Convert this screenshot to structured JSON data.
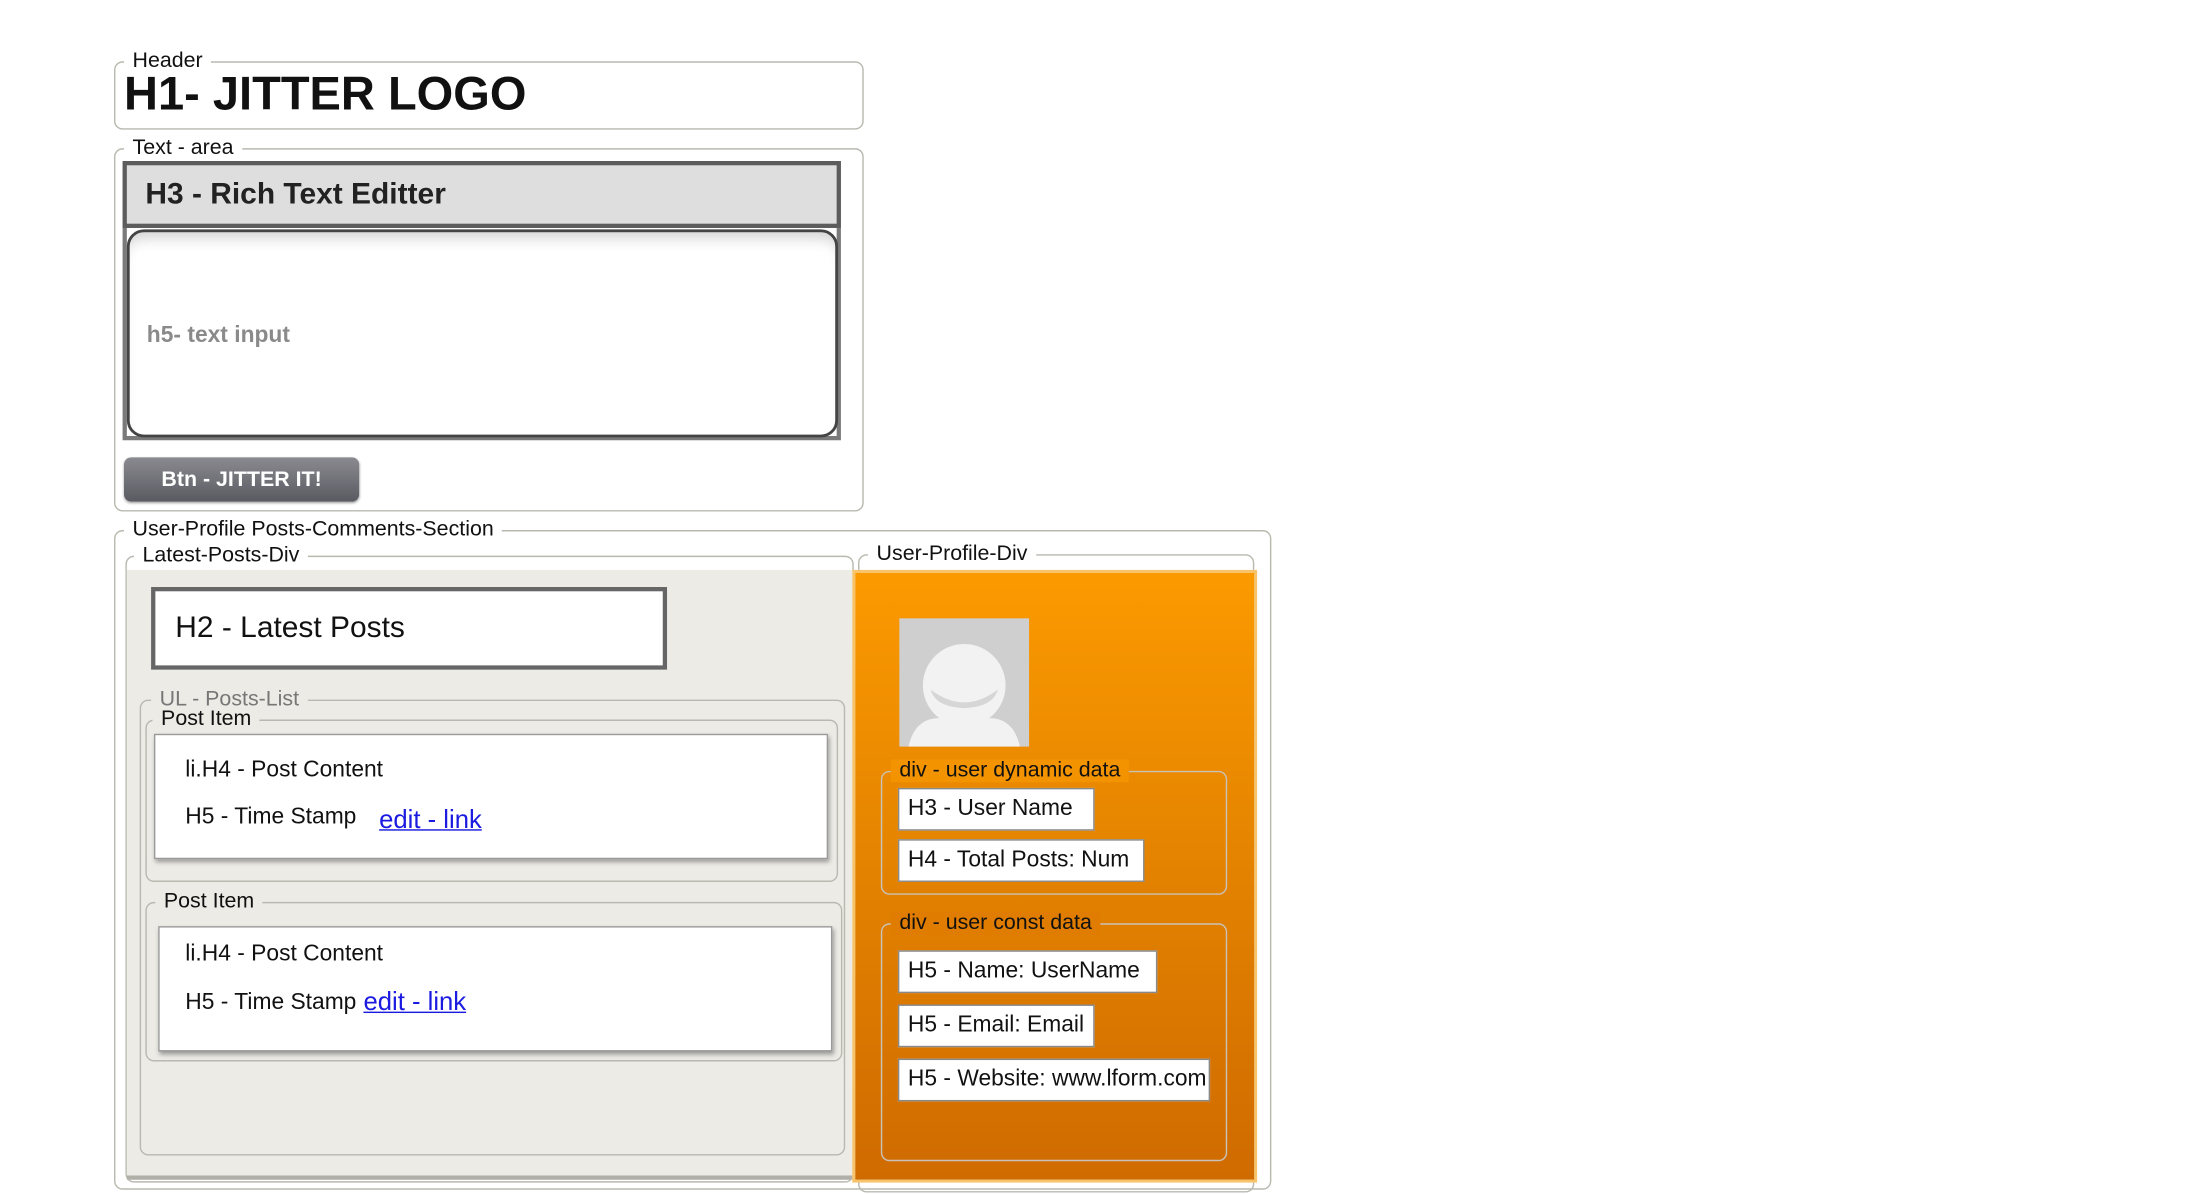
{
  "header": {
    "legend": "Header",
    "logo": "H1- JITTER LOGO"
  },
  "text_area": {
    "legend": "Text - area",
    "editor_title": "H3 - Rich Text Editter",
    "input_placeholder": "h5- text input",
    "submit_button": "Btn - JITTER IT!"
  },
  "section": {
    "legend": "User-Profile Posts-Comments-Section",
    "latest_posts": {
      "legend": "Latest-Posts-Div",
      "heading": "H2 - Latest Posts",
      "list_legend": "UL - Posts-List",
      "items": [
        {
          "legend": "Post Item",
          "content": "li.H4 - Post Content",
          "timestamp": "H5 - Time Stamp",
          "edit_link": "edit - link"
        },
        {
          "legend": "Post Item",
          "content": "li.H4 - Post Content",
          "timestamp": "H5 - Time Stamp",
          "edit_link": "edit - link"
        }
      ]
    },
    "user_profile": {
      "legend": "User-Profile-Div",
      "dynamic": {
        "legend": "div - user dynamic data",
        "user_name": "H3 - User Name",
        "total_posts": "H4 - Total Posts: Num"
      },
      "const": {
        "legend": "div - user const data",
        "name": "H5 - Name: UserName",
        "email": "H5 - Email: Email",
        "website": "H5 - Website: www.lform.com"
      }
    }
  },
  "colors": {
    "orange_top": "#fb9a00",
    "orange_bottom": "#cf6b00",
    "panel_gray": "#ecebe6",
    "link_blue": "#1a1ae0"
  }
}
